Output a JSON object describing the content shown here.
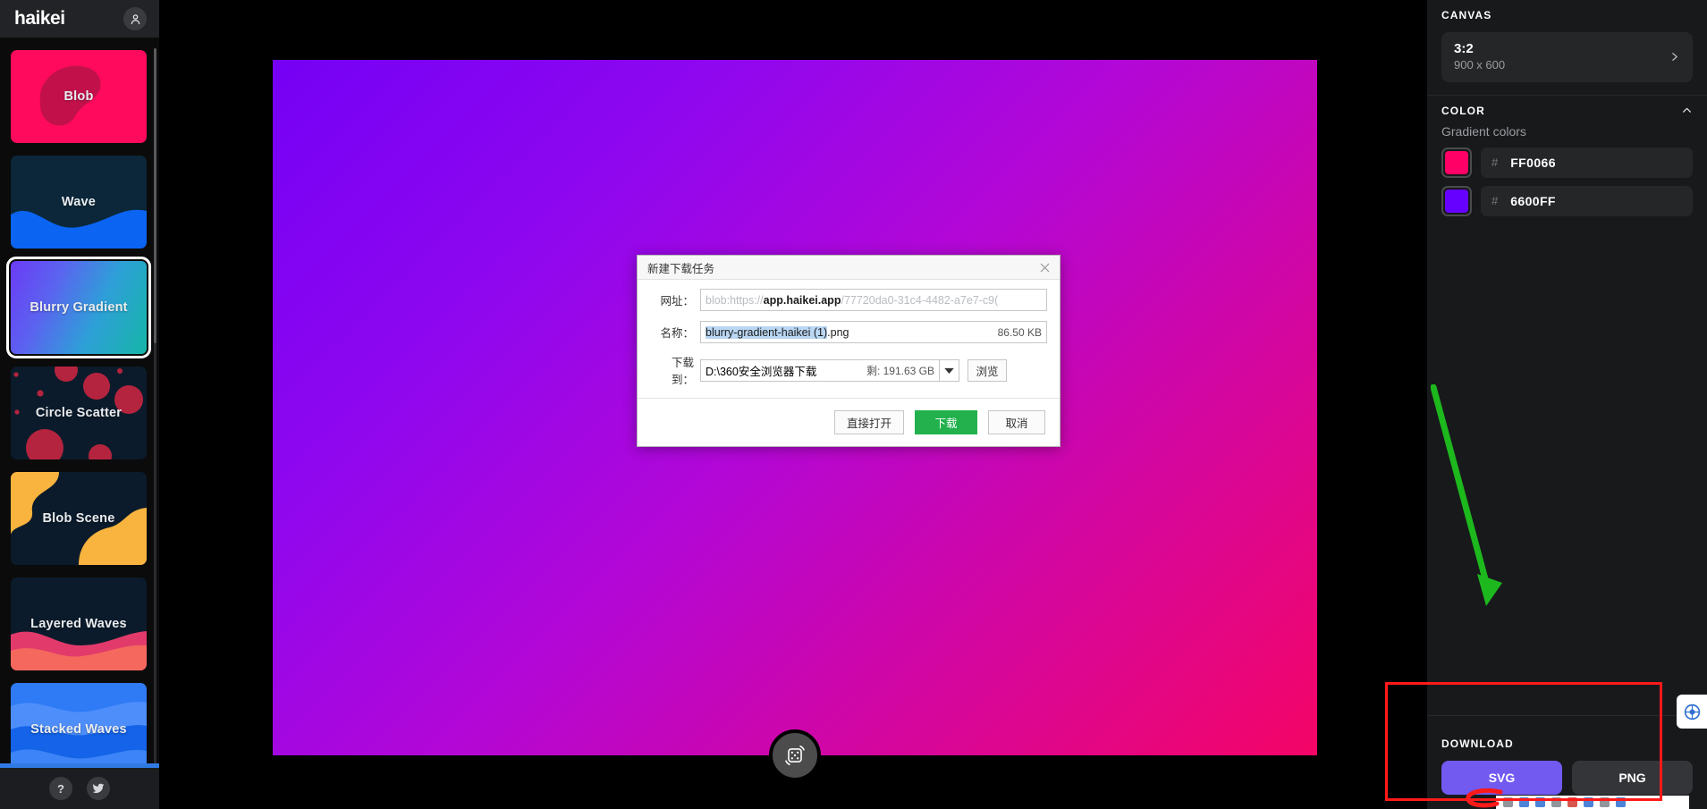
{
  "app": {
    "logo": "haikei",
    "avatar_icon": "user-avatar-icon"
  },
  "sidebar": {
    "presets": [
      {
        "label": "Blob",
        "style": "blob"
      },
      {
        "label": "Wave",
        "style": "wave"
      },
      {
        "label": "Blurry Gradient",
        "style": "blurry-gradient",
        "selected": true
      },
      {
        "label": "Circle Scatter",
        "style": "circle-scatter"
      },
      {
        "label": "Blob Scene",
        "style": "blob-scene"
      },
      {
        "label": "Layered Waves",
        "style": "layered-waves"
      },
      {
        "label": "Stacked Waves",
        "style": "stacked-waves"
      }
    ],
    "footer": {
      "help_label": "?",
      "help_icon": "question-mark-icon",
      "twitter_icon": "twitter-bird-icon"
    }
  },
  "canvas": {
    "randomize_icon": "dice-shuffle-icon",
    "gradient_from": "#7500F5",
    "gradient_to": "#FF0066"
  },
  "right_panel": {
    "canvas": {
      "title": "CANVAS",
      "ratio": "3:2",
      "dimensions": "900 x 600",
      "chevron_icon": "chevron-right-icon"
    },
    "color": {
      "title": "COLOR",
      "collapse_icon": "chevron-up-icon",
      "subtitle": "Gradient colors",
      "swatches": [
        {
          "hash": "#",
          "hex": "FF0066",
          "color": "#FF0066"
        },
        {
          "hash": "#",
          "hex": "6600FF",
          "color": "#6600FF"
        }
      ]
    },
    "download": {
      "title": "DOWNLOAD",
      "svg_label": "SVG",
      "png_label": "PNG"
    }
  },
  "dialog": {
    "title": "新建下载任务",
    "close_icon": "close-x-icon",
    "url": {
      "label": "网址：",
      "prefix": "blob:https://",
      "host": "app.haikei.app",
      "suffix": "/77720da0-31c4-4482-a7e7-c9("
    },
    "name": {
      "label": "名称：",
      "selected": "blurry-gradient-haikei (1)",
      "extension": ".png",
      "size": "86.50 KB"
    },
    "path": {
      "label": "下载到：",
      "value": "D:\\360安全浏览器下载",
      "free_space": "剩: 191.63 GB",
      "dropdown_icon": "chevron-down-icon",
      "browse_label": "浏览"
    },
    "buttons": {
      "open_label": "直接打开",
      "download_label": "下载",
      "cancel_label": "取消"
    }
  },
  "annotations": {
    "highlight_color": "#FF1A1A",
    "arrow_color": "#1DB81D"
  },
  "overlay": {
    "share_icon": "share-badge-icon"
  }
}
